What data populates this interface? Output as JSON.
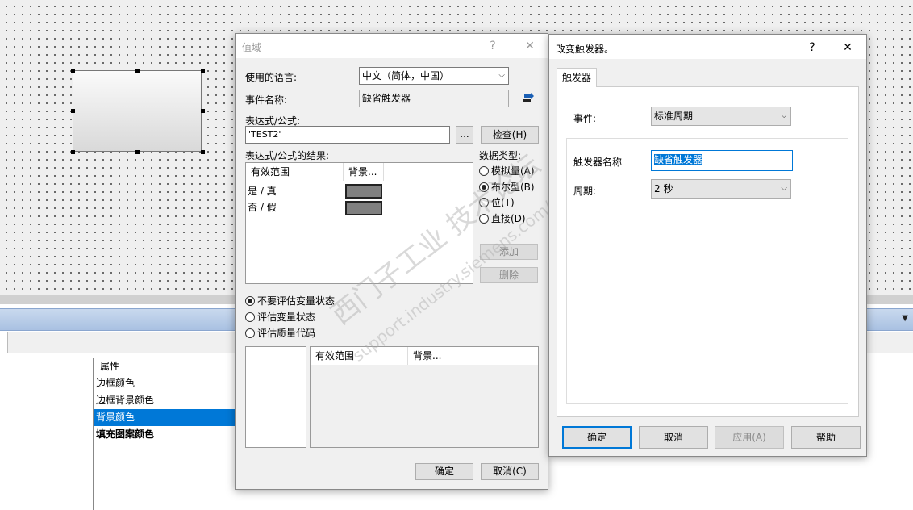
{
  "property_list": {
    "header": "属性",
    "items": [
      "边框颜色",
      "边框背景颜色",
      "背景颜色",
      "填充图案颜色"
    ],
    "selected_index": 2
  },
  "value_dialog": {
    "title": "值域",
    "help": "?",
    "close": "✕",
    "language_label": "使用的语言:",
    "language_value": "中文（简体，中国）",
    "event_name_label": "事件名称:",
    "event_name_value": "缺省触发器",
    "expression_label": "表达式/公式:",
    "expression_value": "'TEST2'",
    "browse_label": "...",
    "check_label": "检查(H)",
    "result_label": "表达式/公式的结果:",
    "result_columns": [
      "有效范围",
      "背景..."
    ],
    "result_rows": [
      {
        "range": "是 / 真",
        "color": "#808080"
      },
      {
        "range": "否 / 假",
        "color": "#808080"
      }
    ],
    "data_type_label": "数据类型:",
    "data_types": [
      "模拟量(A)",
      "布尔型(B)",
      "位(T)",
      "直接(D)"
    ],
    "data_type_selected": 1,
    "add_label": "添加",
    "delete_label": "删除",
    "eval_options": [
      "不要评估变量状态",
      "评估变量状态",
      "评估质量代码"
    ],
    "eval_selected": 0,
    "lower_columns": [
      "有效范围",
      "背景..."
    ],
    "ok_label": "确定",
    "cancel_label": "取消(C)"
  },
  "trigger_dialog": {
    "title": "改变触发器。",
    "help": "?",
    "close": "✕",
    "tab_label": "触发器",
    "event_label": "事件:",
    "event_value": "标准周期",
    "trigger_name_label": "触发器名称",
    "trigger_name_value": "缺省触发器",
    "period_label": "周期:",
    "period_value": "2 秒",
    "ok_label": "确定",
    "cancel_label": "取消",
    "apply_label": "应用(A)",
    "help_label": "帮助"
  },
  "watermark": {
    "line1": "西门子工业  技术论坛",
    "line2": "support.industry.siemens.com/cs"
  }
}
